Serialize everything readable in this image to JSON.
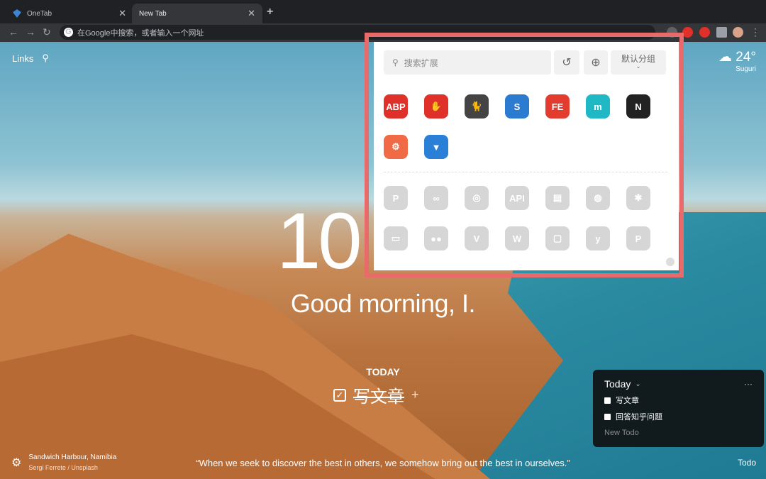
{
  "tabs": [
    {
      "title": "OneTab",
      "active": false
    },
    {
      "title": "New Tab",
      "active": true
    }
  ],
  "omnibox": {
    "placeholder": "在Google中搜索，或者输入一个网址"
  },
  "links_label": "Links",
  "weather": {
    "temp": "24°",
    "location": "Suguri"
  },
  "clock": "10",
  "greeting": "Good morning, I.",
  "focus": {
    "label": "TODAY",
    "task": "写文章"
  },
  "photo": {
    "location": "Sandwich Harbour, Namibia",
    "credit": "Sergi Ferrete / Unsplash"
  },
  "quote": "“When we seek to discover the best in others, we somehow bring out the best in ourselves.”",
  "todo_button": "Todo",
  "todo": {
    "title": "Today",
    "items": [
      "写文章",
      "回答知乎问题"
    ],
    "new_placeholder": "New Todo"
  },
  "popup": {
    "search_placeholder": "搜索扩展",
    "group_label": "默认分组",
    "enabled": [
      {
        "name": "abp-icon",
        "label": "ABP",
        "color": "#e0302a"
      },
      {
        "name": "adblock-hand-icon",
        "label": "✋",
        "color": "#e0302a"
      },
      {
        "name": "cat-icon",
        "label": "🐈",
        "color": "#444444"
      },
      {
        "name": "s-icon",
        "label": "S",
        "color": "#2b7bd1"
      },
      {
        "name": "fe-icon",
        "label": "FE",
        "color": "#e33b2e"
      },
      {
        "name": "m-icon",
        "label": "m",
        "color": "#1fb8c4"
      },
      {
        "name": "notion-icon",
        "label": "N",
        "color": "#222222"
      },
      {
        "name": "sitemap-icon",
        "label": "⚙",
        "color": "#f06a45"
      },
      {
        "name": "funnel-icon",
        "label": "▼",
        "color": "#2a7fd6"
      }
    ],
    "disabled": [
      {
        "name": "p-icon",
        "label": "P"
      },
      {
        "name": "infinity-icon",
        "label": "∞"
      },
      {
        "name": "lifebuoy-icon",
        "label": "◎"
      },
      {
        "name": "api-icon",
        "label": "API"
      },
      {
        "name": "printer-icon",
        "label": "▤"
      },
      {
        "name": "bowl-icon",
        "label": "◍"
      },
      {
        "name": "asterisk-icon",
        "label": "✱"
      },
      {
        "name": "window-icon",
        "label": "▭"
      },
      {
        "name": "dots-icon",
        "label": "●●"
      },
      {
        "name": "v-icon",
        "label": "V"
      },
      {
        "name": "w-icon",
        "label": "W"
      },
      {
        "name": "frame-icon",
        "label": "▢"
      },
      {
        "name": "y-icon",
        "label": "y"
      },
      {
        "name": "parking-icon",
        "label": "P"
      }
    ]
  }
}
